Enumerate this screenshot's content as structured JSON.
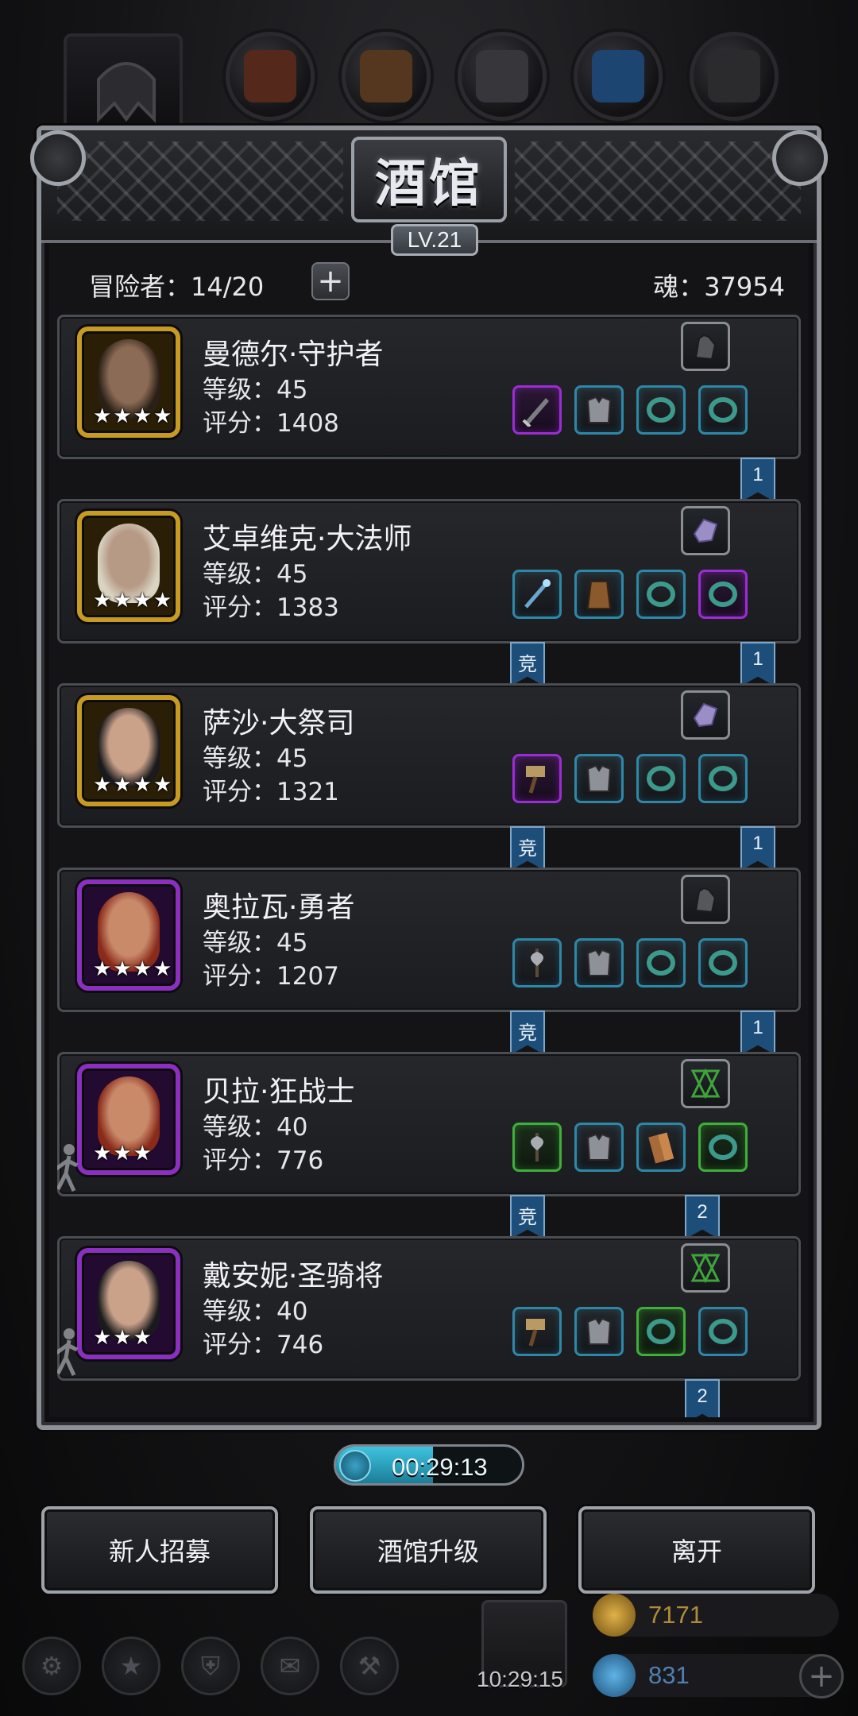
{
  "panel": {
    "title": "酒馆",
    "level": "LV.21"
  },
  "stats": {
    "adventurers": "冒险者：14/20",
    "add_label": "+",
    "soul": "魂：37954"
  },
  "characters": [
    {
      "name": "曼德尔·守护者",
      "level": "等级：45",
      "score": "评分：1408",
      "frame": "gold",
      "stars": 4,
      "accessory": "gauntlet-icon",
      "slots": [
        [
          "sword-icon",
          "purple"
        ],
        [
          "armor-icon",
          "blue"
        ],
        [
          "ring-icon",
          "blue"
        ],
        [
          "ring-icon",
          "blue"
        ]
      ],
      "flags": [
        {
          "pos": "right",
          "text": "1"
        }
      ],
      "figure": false
    },
    {
      "name": "艾卓维克·大法师",
      "level": "等级：45",
      "score": "评分：1383",
      "frame": "gold",
      "stars": 4,
      "accessory": "crystal-icon",
      "slots": [
        [
          "staff-icon",
          "blue"
        ],
        [
          "robe-icon",
          "blue"
        ],
        [
          "ring-icon",
          "blue"
        ],
        [
          "ring-icon",
          "purple"
        ]
      ],
      "flags": [
        {
          "pos": "left",
          "text": "竞"
        },
        {
          "pos": "right",
          "text": "1"
        }
      ],
      "figure": false
    },
    {
      "name": "萨沙·大祭司",
      "level": "等级：45",
      "score": "评分：1321",
      "frame": "gold",
      "stars": 4,
      "accessory": "crystal-icon",
      "slots": [
        [
          "hammer-icon",
          "purple"
        ],
        [
          "armor-icon",
          "blue"
        ],
        [
          "ring-icon",
          "blue"
        ],
        [
          "ring-icon",
          "blue"
        ]
      ],
      "flags": [
        {
          "pos": "left",
          "text": "竞"
        },
        {
          "pos": "right",
          "text": "1"
        }
      ],
      "figure": false
    },
    {
      "name": "奥拉瓦·勇者",
      "level": "等级：45",
      "score": "评分：1207",
      "frame": "purple",
      "stars": 4,
      "accessory": "gauntlet-icon",
      "slots": [
        [
          "axe-icon",
          "blue"
        ],
        [
          "armor-icon",
          "blue"
        ],
        [
          "ring-icon",
          "blue"
        ],
        [
          "ring-icon",
          "blue"
        ]
      ],
      "flags": [
        {
          "pos": "left",
          "text": "竞"
        },
        {
          "pos": "right",
          "text": "1"
        }
      ],
      "figure": false
    },
    {
      "name": "贝拉·狂战士",
      "level": "等级：40",
      "score": "评分：776",
      "frame": "purple",
      "stars": 3,
      "accessory": "emblem-icon",
      "slots": [
        [
          "axe-icon",
          "green"
        ],
        [
          "armor-icon",
          "blue"
        ],
        [
          "wood-icon",
          "blue"
        ],
        [
          "ring-icon",
          "green"
        ]
      ],
      "flags": [
        {
          "pos": "left",
          "text": "竞"
        },
        {
          "pos": "mid",
          "text": "2"
        }
      ],
      "figure": true
    },
    {
      "name": "戴安妮·圣骑将",
      "level": "等级：40",
      "score": "评分：746",
      "frame": "purple",
      "stars": 3,
      "accessory": "emblem-icon",
      "slots": [
        [
          "hammer-icon",
          "blue"
        ],
        [
          "armor-icon",
          "blue"
        ],
        [
          "ring-icon",
          "green"
        ],
        [
          "ring-icon",
          "blue"
        ]
      ],
      "flags": [
        {
          "pos": "mid",
          "text": "2"
        }
      ],
      "figure": true
    }
  ],
  "timer": {
    "text": "00:29:13",
    "progress": 0.52
  },
  "actions": {
    "recruit": "新人招募",
    "upgrade": "酒馆升级",
    "leave": "离开"
  },
  "bottom": {
    "clock": "10:29:15",
    "gold": "7171",
    "gems": "831"
  },
  "colors": {
    "gold_frame": "#c79a22",
    "purple_frame": "#8a2fbf",
    "blue_rarity": "#2f87a8",
    "green_rarity": "#3fae3a",
    "flag": "#1d4e7a"
  }
}
